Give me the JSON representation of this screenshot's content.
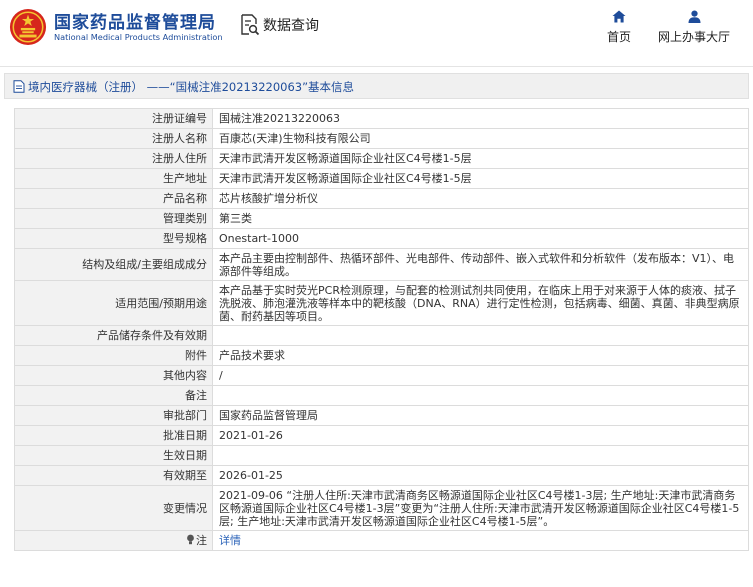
{
  "header": {
    "brand_cn": "国家药品监督管理局",
    "brand_en": "National Medical Products Administration",
    "search_label": "数据查询",
    "nav": {
      "home": "首页",
      "service": "网上办事大厅"
    },
    "colors": {
      "brand": "#1e4c9a",
      "emblem": "#d6261c",
      "gold": "#f4c531"
    },
    "icons": [
      "emblem-icon",
      "search-document-icon",
      "home-icon",
      "user-icon"
    ]
  },
  "breadcrumb": {
    "text": "境内医疗器械（注册） ——“国械注准20213220063”基本信息",
    "icon": "document-icon"
  },
  "rows": [
    {
      "label": "注册证编号",
      "value": "国械注准20213220063"
    },
    {
      "label": "注册人名称",
      "value": "百康芯(天津)生物科技有限公司"
    },
    {
      "label": "注册人住所",
      "value": "天津市武清开发区畅源道国际企业社区C4号楼1-5层"
    },
    {
      "label": "生产地址",
      "value": "天津市武清开发区畅源道国际企业社区C4号楼1-5层"
    },
    {
      "label": "产品名称",
      "value": "芯片核酸扩增分析仪"
    },
    {
      "label": "管理类别",
      "value": "第三类"
    },
    {
      "label": "型号规格",
      "value": "Onestart-1000"
    },
    {
      "label": "结构及组成/主要组成成分",
      "value": "本产品主要由控制部件、热循环部件、光电部件、传动部件、嵌入式软件和分析软件（发布版本：V1）、电源部件等组成。"
    },
    {
      "label": "适用范围/预期用途",
      "value": "本产品基于实时荧光PCR检测原理，与配套的检测试剂共同使用，在临床上用于对来源于人体的痰液、拭子洗脱液、肺泡灌洗液等样本中的靶核酸（DNA、RNA）进行定性检测，包括病毒、细菌、真菌、非典型病原菌、耐药基因等项目。"
    },
    {
      "label": "产品储存条件及有效期",
      "value": ""
    },
    {
      "label": "附件",
      "value": "产品技术要求"
    },
    {
      "label": "其他内容",
      "value": "/"
    },
    {
      "label": "备注",
      "value": ""
    },
    {
      "label": "审批部门",
      "value": "国家药品监督管理局"
    },
    {
      "label": "批准日期",
      "value": "2021-01-26"
    },
    {
      "label": "生效日期",
      "value": ""
    },
    {
      "label": "有效期至",
      "value": "2026-01-25"
    },
    {
      "label": "变更情况",
      "value": "2021-09-06 “注册人住所:天津市武清商务区畅源道国际企业社区C4号楼1-3层; 生产地址:天津市武清商务区畅源道国际企业社区C4号楼1-3层”变更为“注册人住所:天津市武清开发区畅源道国际企业社区C4号楼1-5层; 生产地址:天津市武清开发区畅源道国际企业社区C4号楼1-5层”。"
    }
  ],
  "note": {
    "label": "注",
    "link": "详情",
    "icon": "lightbulb-icon"
  }
}
